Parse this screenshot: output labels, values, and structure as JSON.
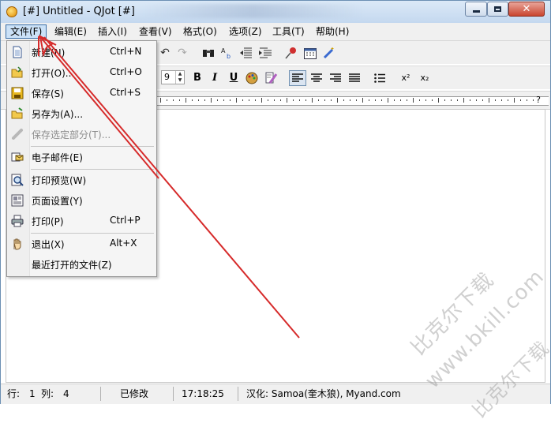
{
  "window": {
    "title": "[#] Untitled - QJot [#]"
  },
  "menubar": {
    "items": [
      {
        "label": "文件(F)"
      },
      {
        "label": "编辑(E)"
      },
      {
        "label": "插入(I)"
      },
      {
        "label": "查看(V)"
      },
      {
        "label": "格式(O)"
      },
      {
        "label": "选项(Z)"
      },
      {
        "label": "工具(T)"
      },
      {
        "label": "帮助(H)"
      }
    ]
  },
  "toolbar": {
    "font_size": "9"
  },
  "format": {
    "bold": "B",
    "italic": "I",
    "underline": "U",
    "superscript": "x²",
    "subscript": "x₂"
  },
  "ruler": {
    "end_marker": "?"
  },
  "file_menu": {
    "items": [
      {
        "label": "新建(N)",
        "shortcut": "Ctrl+N",
        "icon": "new-document-icon",
        "enabled": true
      },
      {
        "label": "打开(O)...",
        "shortcut": "Ctrl+O",
        "icon": "open-folder-icon",
        "enabled": true
      },
      {
        "label": "保存(S)",
        "shortcut": "Ctrl+S",
        "icon": "save-disk-icon",
        "enabled": true
      },
      {
        "label": "另存为(A)...",
        "shortcut": "",
        "icon": "save-as-icon",
        "enabled": true
      },
      {
        "label": "保存选定部分(T)...",
        "shortcut": "",
        "icon": "save-selection-icon",
        "enabled": false
      },
      {
        "label": "电子邮件(E)",
        "shortcut": "",
        "icon": "email-icon",
        "enabled": true
      },
      {
        "label": "打印预览(W)",
        "shortcut": "",
        "icon": "print-preview-icon",
        "enabled": true
      },
      {
        "label": "页面设置(Y)",
        "shortcut": "",
        "icon": "page-setup-icon",
        "enabled": true
      },
      {
        "label": "打印(P)",
        "shortcut": "Ctrl+P",
        "icon": "printer-icon",
        "enabled": true
      },
      {
        "label": "退出(X)",
        "shortcut": "Alt+X",
        "icon": "exit-hand-icon",
        "enabled": true
      },
      {
        "label": "最近打开的文件(Z)",
        "shortcut": "",
        "icon": "",
        "enabled": true
      }
    ]
  },
  "statusbar": {
    "row_label": "行:",
    "row": "1",
    "col_label": "列:",
    "col": "4",
    "modified": "已修改",
    "time": "17:18:25",
    "credit": "汉化: Samoa(奎木狼), Myand.com"
  },
  "watermark": {
    "lines": [
      "比克尔下载",
      "www.bkill.com",
      "比克尔下载"
    ]
  },
  "colors": {
    "arrow": "#d62a2a",
    "menu_highlight": "#cbe1f7",
    "menu_highlight_border": "#3c6fa8"
  }
}
